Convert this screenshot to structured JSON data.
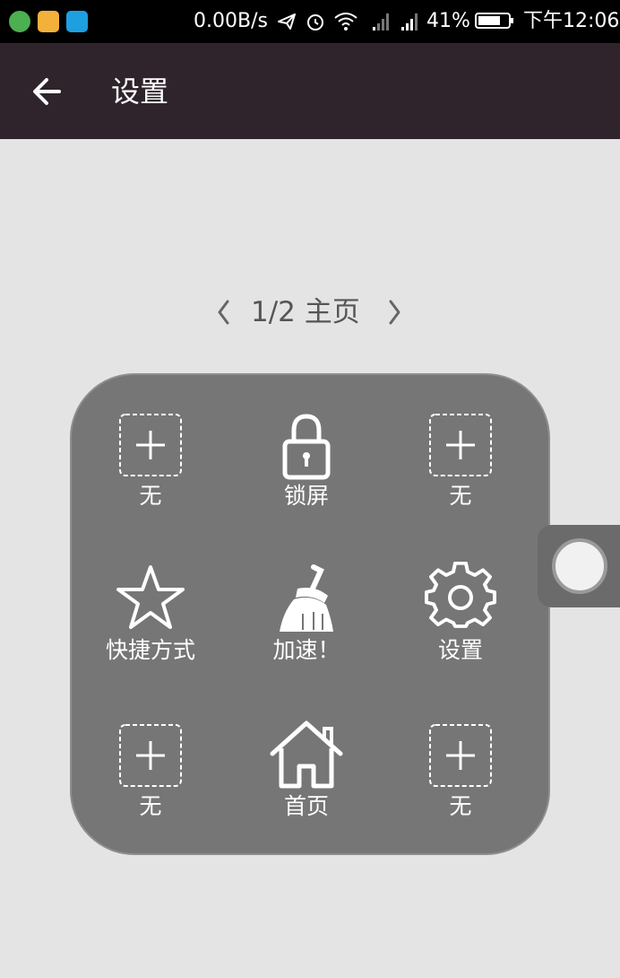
{
  "status_bar": {
    "net_speed": "0.00B/s",
    "battery_percent": "41%",
    "battery_level": 0.41,
    "time": "下午12:06",
    "icons": [
      "wechat-icon",
      "weibo-icon",
      "qq-icon",
      "send-icon",
      "alarm-icon",
      "wifi-icon",
      "signal-icon",
      "signal-icon",
      "battery-icon"
    ]
  },
  "toolbar": {
    "back_icon": "arrow-left-icon",
    "title": "设置"
  },
  "pager": {
    "label": "1/2 主页",
    "prev_icon": "chevron-left-icon",
    "next_icon": "chevron-right-icon"
  },
  "panel": {
    "items": [
      {
        "label": "无",
        "icon": "add-icon"
      },
      {
        "label": "锁屏",
        "icon": "lock-icon"
      },
      {
        "label": "无",
        "icon": "add-icon"
      },
      {
        "label": "快捷方式",
        "icon": "star-icon"
      },
      {
        "label": "加速！",
        "icon": "broom-icon"
      },
      {
        "label": "设置",
        "icon": "gear-icon"
      },
      {
        "label": "无",
        "icon": "add-icon"
      },
      {
        "label": "首页",
        "icon": "home-icon"
      },
      {
        "label": "无",
        "icon": "add-icon"
      }
    ]
  },
  "float_button": {
    "icon": "assistive-touch-icon"
  },
  "colors": {
    "toolbar_bg": "#2f242b",
    "page_bg": "#e4e4e4",
    "panel_bg": "#767676"
  }
}
